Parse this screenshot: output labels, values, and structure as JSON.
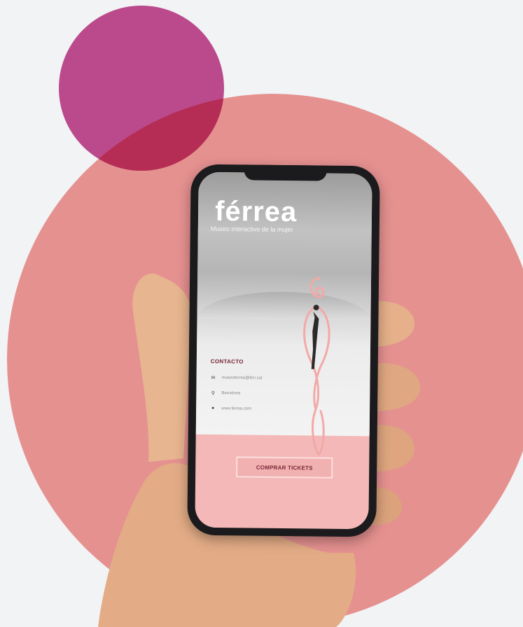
{
  "colors": {
    "page_background": "#f2f3f5",
    "large_circle": "#e59190",
    "small_circle": "#bb4a8d",
    "circle_overlap": "#b52d54",
    "screen_bottom": "#f3b8b7",
    "accent_text": "#7a2838"
  },
  "app": {
    "brand": "férrea",
    "tagline": "Museo interactivo de la mujer"
  },
  "contact": {
    "title": "CONTACTO",
    "items": [
      {
        "icon": "mail-icon",
        "glyph": "✉",
        "text": "museoferrea@ferr.cat"
      },
      {
        "icon": "location-pin-icon",
        "glyph": "⚲",
        "text": "Barcelona"
      },
      {
        "icon": "globe-icon",
        "glyph": "●",
        "text": "www.ferrea.com"
      }
    ]
  },
  "cta": {
    "label": "COMPRAR TICKETS"
  }
}
